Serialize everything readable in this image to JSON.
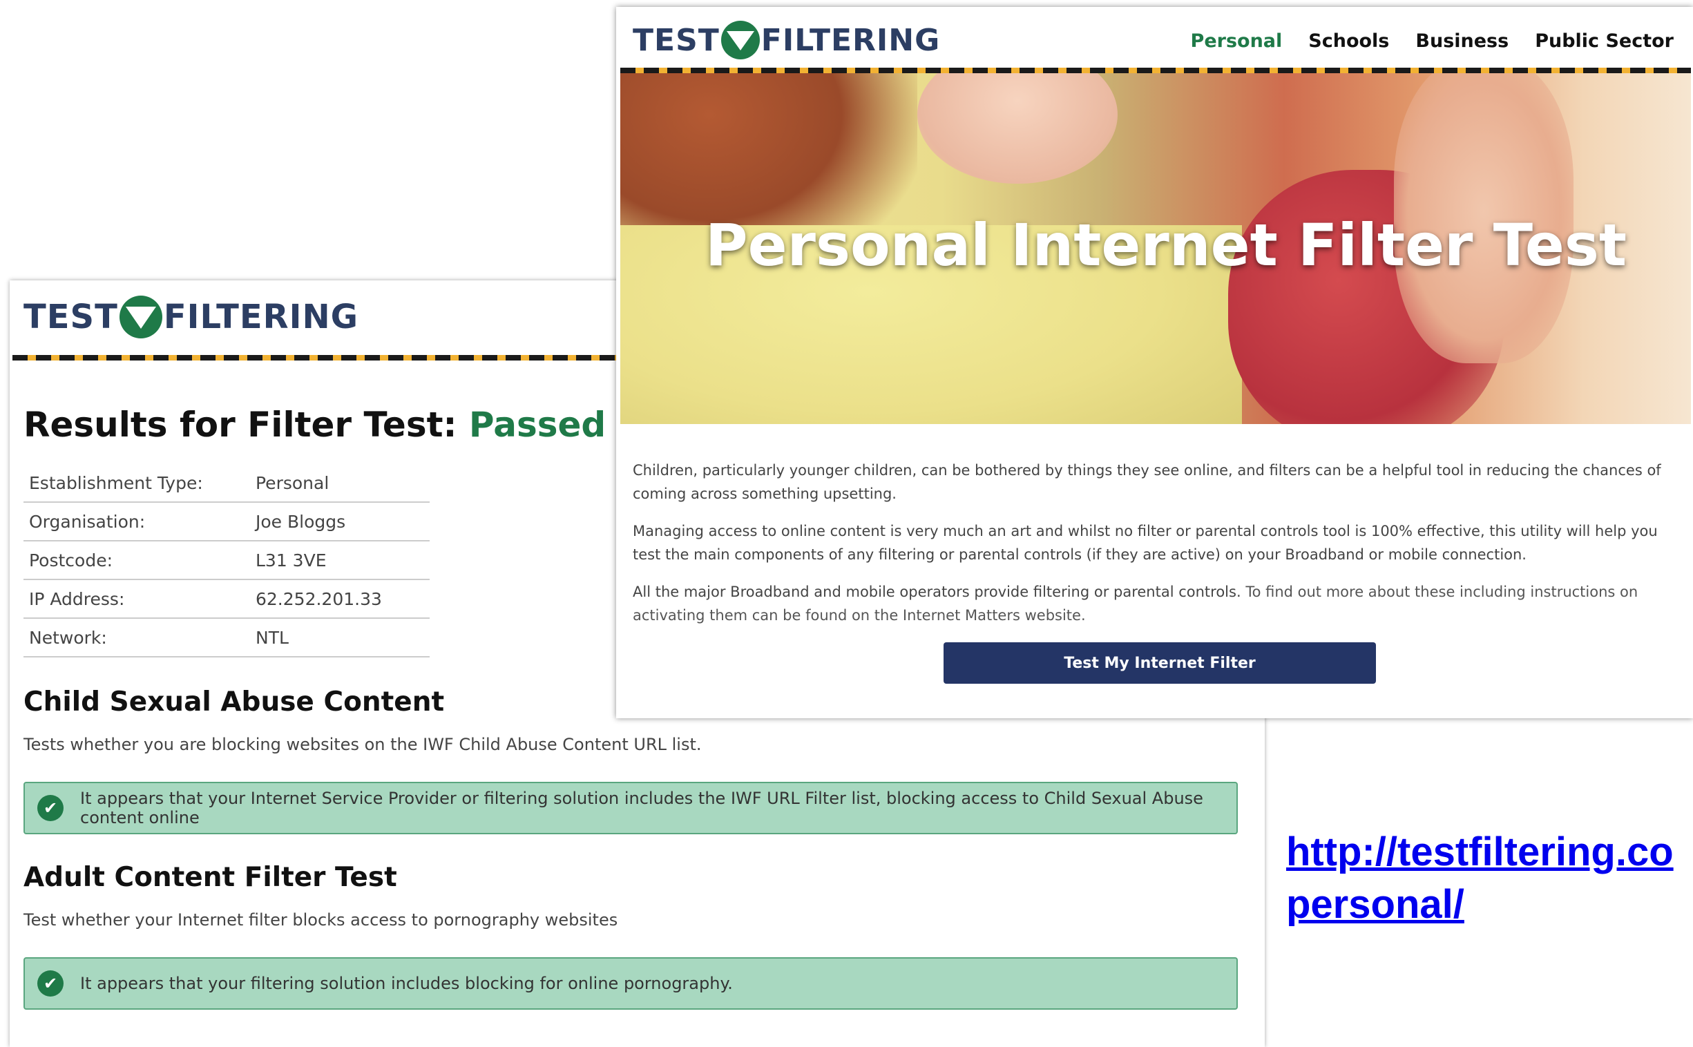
{
  "brand": {
    "word1": "TEST",
    "word2": "FILTERING",
    "logo_icon": "funnel-icon",
    "colors": {
      "green": "#1f7a48",
      "navy": "#2c3e63",
      "gold": "#f2b233"
    }
  },
  "results_page": {
    "title_prefix": "Results for Filter Test:",
    "title_status": "Passed",
    "info_rows": [
      {
        "label": "Establishment Type:",
        "value": "Personal"
      },
      {
        "label": "Organisation:",
        "value": "Joe Bloggs"
      },
      {
        "label": "Postcode:",
        "value": "L31 3VE"
      },
      {
        "label": "IP Address:",
        "value": "62.252.201.33"
      },
      {
        "label": "Network:",
        "value": "NTL"
      }
    ],
    "sections": [
      {
        "heading": "Child Sexual Abuse Content",
        "description": "Tests whether you are blocking websites on the IWF Child Abuse Content URL list.",
        "result": "It appears that your Internet Service Provider or filtering solution includes the IWF URL Filter list, blocking access to Child Sexual Abuse content online"
      },
      {
        "heading": "Adult Content Filter Test",
        "description": "Test whether your Internet filter blocks access to pornography websites",
        "result": "It appears that your filtering solution includes blocking for online pornography."
      }
    ]
  },
  "personal_page": {
    "nav": [
      "Personal",
      "Schools",
      "Business",
      "Public Sector"
    ],
    "active_nav": "Personal",
    "hero_title": "Personal Internet Filter Test",
    "paragraphs": [
      "Children, particularly younger children, can be bothered by things they see online, and filters can be a helpful tool in reducing the chances of coming across something upsetting.",
      "Managing access to online content is very much an art and whilst no filter or parental controls tool is 100% effective, this utility will help you test the main components of any filtering or parental controls (if they are active) on your Broadband or mobile connection.",
      "All the major Broadband and mobile operators provide filtering or parental controls.",
      "To find out more about these including instructions on activating them can be found on the Internet Matters website."
    ],
    "cta_label": "Test My Internet Filter"
  },
  "url_caption": {
    "line1": "http://testfiltering.co",
    "line2": "personal/"
  }
}
